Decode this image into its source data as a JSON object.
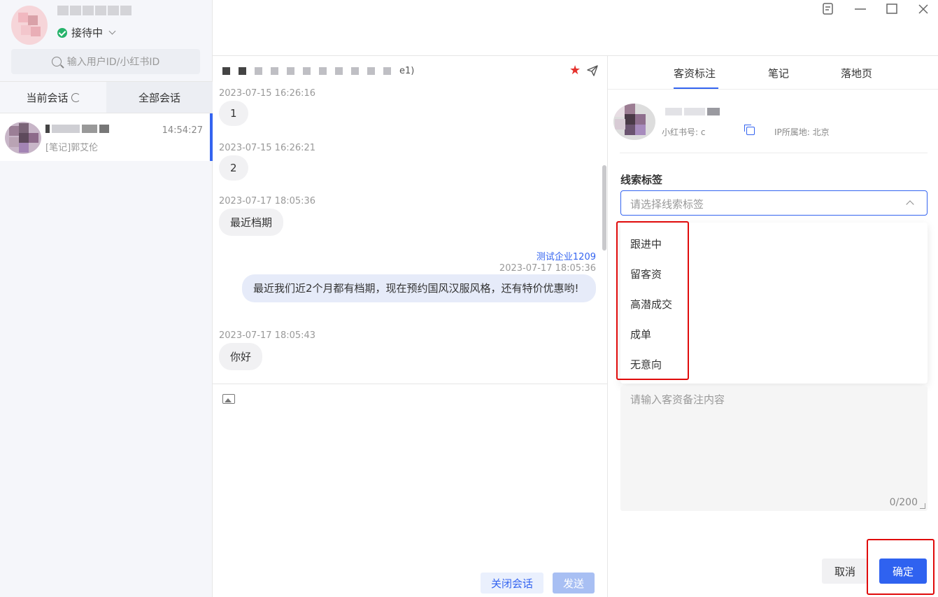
{
  "sidebar": {
    "status_label": "接待中",
    "search_placeholder": "输入用户ID/小红书ID",
    "tabs": [
      {
        "label": "当前会话"
      },
      {
        "label": "全部会话"
      }
    ],
    "conversations": [
      {
        "time": "14:54:27",
        "preview": "[笔记]郭艾伦"
      }
    ]
  },
  "chat": {
    "title_suffix": "e1)",
    "messages": [
      {
        "side": "left",
        "timestamp": "2023-07-15 16:26:16",
        "text": "1"
      },
      {
        "side": "left",
        "timestamp": "2023-07-15 16:26:21",
        "text": "2"
      },
      {
        "side": "left",
        "timestamp": "2023-07-17 18:05:36",
        "text": "最近档期"
      },
      {
        "side": "right",
        "sender": "测试企业1209",
        "timestamp": "2023-07-17 18:05:36",
        "text": "最近我们近2个月都有档期，现在预约国风汉服风格，还有特价优惠哟!"
      },
      {
        "side": "left",
        "timestamp": "2023-07-17 18:05:43",
        "text": "你好"
      }
    ],
    "close_button": "关闭会话",
    "send_button": "发送"
  },
  "right_panel": {
    "tabs": [
      {
        "label": "客资标注",
        "active": true
      },
      {
        "label": "笔记"
      },
      {
        "label": "落地页"
      }
    ],
    "customer": {
      "id_label": "小红书号: c",
      "ip_label": "IP所属地: 北京"
    },
    "lead_tag": {
      "label": "线索标签",
      "placeholder": "请选择线索标签",
      "options": [
        "跟进中",
        "留客资",
        "高潜成交",
        "成单",
        "无意向"
      ]
    },
    "remark": {
      "placeholder": "请输入客资备注内容",
      "counter": "0/200"
    },
    "cancel_button": "取消",
    "confirm_button": "确定"
  },
  "colors": {
    "accent": "#3464f0",
    "highlight": "#e00b0b",
    "online": "#27b36b"
  }
}
